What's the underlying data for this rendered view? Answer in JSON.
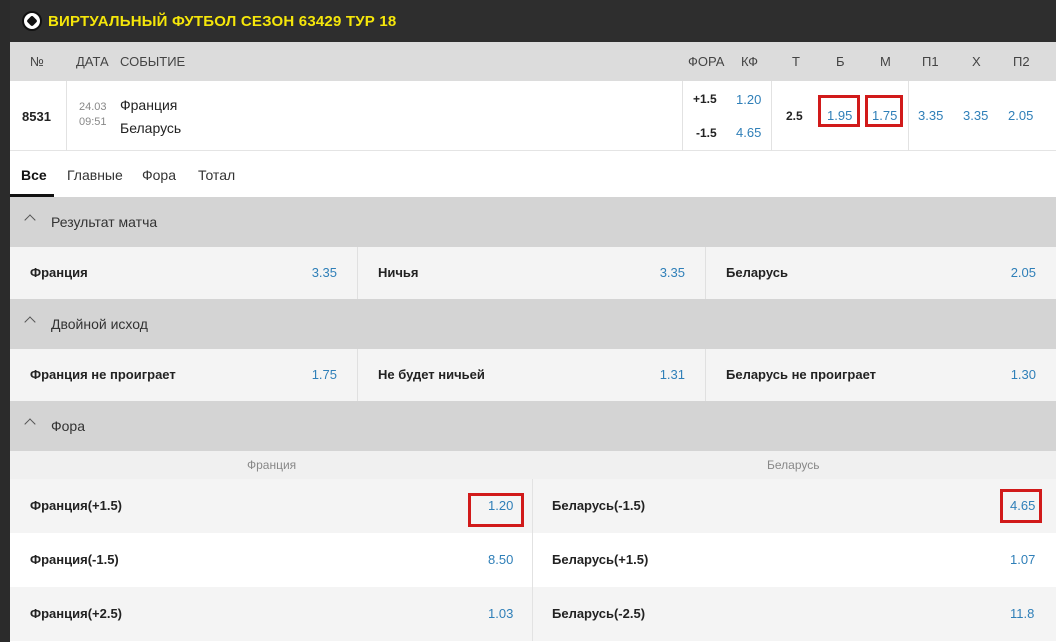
{
  "header": {
    "title": "ВИРТУАЛЬНЫЙ ФУТБОЛ СЕЗОН 63429 ТУР 18",
    "icon": "soccer-ball-icon"
  },
  "columns": {
    "num": "№",
    "date": "ДАТА",
    "event": "СОБЫТИЕ",
    "fora": "ФОРА",
    "kf": "КФ",
    "t": "Т",
    "b": "Б",
    "m": "М",
    "p1": "П1",
    "x": "Х",
    "p2": "П2"
  },
  "match": {
    "id": "8531",
    "date": "24.03",
    "time": "09:51",
    "team1": "Франция",
    "team2": "Беларусь",
    "fora1": "+1.5",
    "kf1": "1.20",
    "fora2": "-1.5",
    "kf2": "4.65",
    "total": "2.5",
    "b": "1.95",
    "m": "1.75",
    "p1": "3.35",
    "x": "3.35",
    "p2": "2.05"
  },
  "tabs": [
    "Все",
    "Главные",
    "Фора",
    "Тотал"
  ],
  "sections": {
    "result": {
      "title": "Результат матча",
      "cells": [
        {
          "label": "Франция",
          "odd": "3.35"
        },
        {
          "label": "Ничья",
          "odd": "3.35"
        },
        {
          "label": "Беларусь",
          "odd": "2.05"
        }
      ]
    },
    "double": {
      "title": "Двойной исход",
      "cells": [
        {
          "label": "Франция не проиграет",
          "odd": "1.75"
        },
        {
          "label": "Не будет ничьей",
          "odd": "1.31"
        },
        {
          "label": "Беларусь не проиграет",
          "odd": "1.30"
        }
      ]
    },
    "fora": {
      "title": "Фора",
      "left_header": "Франция",
      "right_header": "Беларусь",
      "rows": [
        {
          "left_label": "Франция(+1.5)",
          "left_odd": "1.20",
          "right_label": "Беларусь(-1.5)",
          "right_odd": "4.65"
        },
        {
          "left_label": "Франция(-1.5)",
          "left_odd": "8.50",
          "right_label": "Беларусь(+1.5)",
          "right_odd": "1.07"
        },
        {
          "left_label": "Франция(+2.5)",
          "left_odd": "1.03",
          "right_label": "Беларусь(-2.5)",
          "right_odd": "11.8"
        }
      ]
    }
  },
  "colors": {
    "accent_title": "#f5e60a",
    "odd_blue": "#2f7fb8",
    "highlight_red": "#d11a1a"
  }
}
